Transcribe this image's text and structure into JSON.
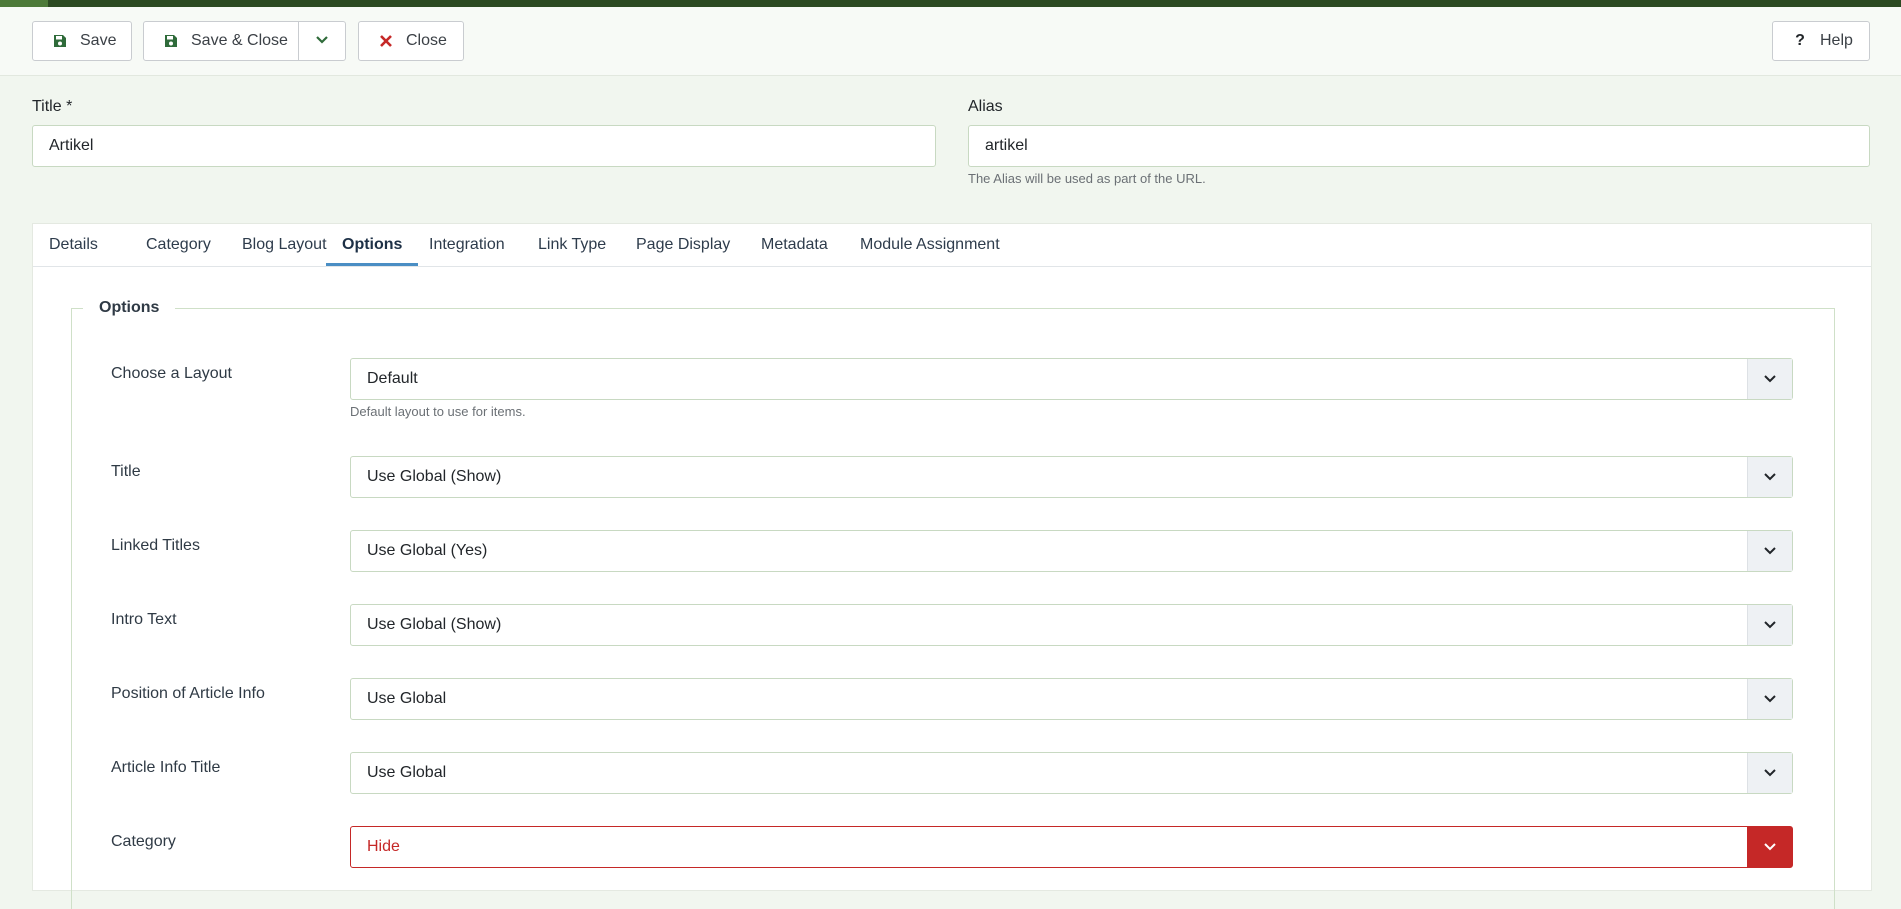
{
  "toolbar": {
    "save_label": "Save",
    "save_close_label": "Save & Close",
    "close_label": "Close",
    "help_label": "Help"
  },
  "form": {
    "title_label": "Title *",
    "title_value": "Artikel",
    "alias_label": "Alias",
    "alias_value": "artikel",
    "alias_hint": "The Alias will be used as part of the URL."
  },
  "tabs": [
    {
      "label": "Details"
    },
    {
      "label": "Category"
    },
    {
      "label": "Blog Layout"
    },
    {
      "label": "Options",
      "active": true
    },
    {
      "label": "Integration"
    },
    {
      "label": "Link Type"
    },
    {
      "label": "Page Display"
    },
    {
      "label": "Metadata"
    },
    {
      "label": "Module Assignment"
    }
  ],
  "options": {
    "legend": "Options",
    "rows": [
      {
        "label": "Choose a Layout",
        "value": "Default",
        "hint": "Default layout to use for items."
      },
      {
        "label": "Title",
        "value": "Use Global (Show)"
      },
      {
        "label": "Linked Titles",
        "value": "Use Global (Yes)"
      },
      {
        "label": "Intro Text",
        "value": "Use Global (Show)"
      },
      {
        "label": "Position of Article Info",
        "value": "Use Global"
      },
      {
        "label": "Article Info Title",
        "value": "Use Global"
      },
      {
        "label": "Category",
        "value": "Hide",
        "invalid": true
      }
    ]
  },
  "colors": {
    "top_bar": "#2c4a22",
    "page_bg": "#f1f6ef",
    "save_icon": "#2f6b3a",
    "close_icon": "#c52827",
    "active_tab_underline": "#4a8ec4",
    "invalid": "#c52827"
  },
  "icons": {
    "save": "floppy-disk-icon",
    "save_close": "floppy-disk-icon",
    "dropdown": "chevron-down-icon",
    "close": "times-icon",
    "help": "question-icon"
  }
}
